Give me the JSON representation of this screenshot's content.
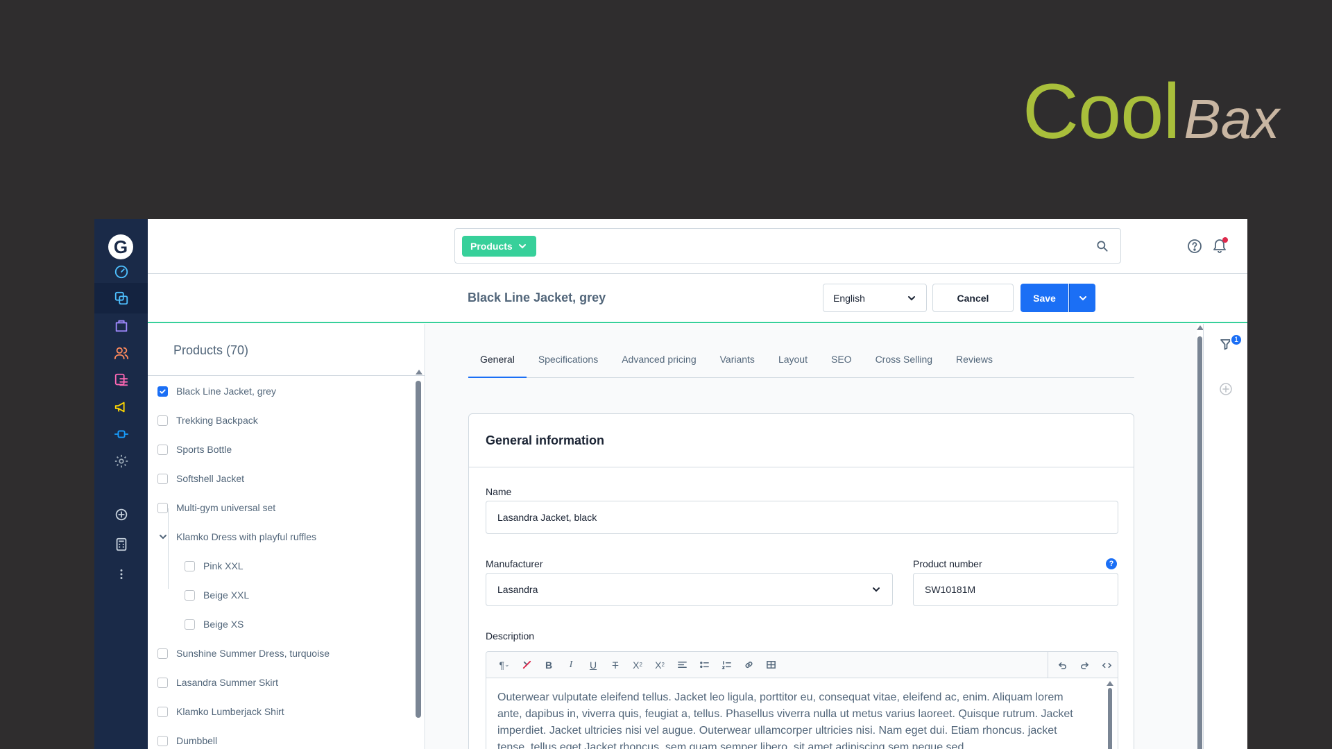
{
  "brand": {
    "cool": "Cool",
    "bax": "Bax"
  },
  "sidebar": {
    "logo": "G",
    "items": [
      {
        "icon": "dashboard-icon",
        "color": "#4ec0ff"
      },
      {
        "icon": "catalog-icon",
        "color": "#4ec0ff"
      },
      {
        "icon": "orders-icon",
        "color": "#a089ff"
      },
      {
        "icon": "customers-icon",
        "color": "#ff8a5c"
      },
      {
        "icon": "content-icon",
        "color": "#ff68b4"
      },
      {
        "icon": "marketing-icon",
        "color": "#ffd700"
      },
      {
        "icon": "extensions-icon",
        "color": "#189eff"
      },
      {
        "icon": "settings-icon",
        "color": "#9aa8b5"
      },
      {
        "icon": "add-icon",
        "color": "#c5d0db"
      },
      {
        "icon": "calculator-icon",
        "color": "#c5d0db"
      },
      {
        "icon": "more-icon",
        "color": "#c5d0db"
      }
    ]
  },
  "search": {
    "tag": "Products"
  },
  "header": {
    "title": "Black Line Jacket, grey",
    "language": "English",
    "cancel": "Cancel",
    "save": "Save"
  },
  "list": {
    "title": "Products (70)",
    "items": [
      {
        "label": "Black Line Jacket, grey",
        "checked": true,
        "level": 0
      },
      {
        "label": "Trekking Backpack",
        "checked": false,
        "level": 0
      },
      {
        "label": "Sports Bottle",
        "checked": false,
        "level": 0
      },
      {
        "label": "Softshell Jacket",
        "checked": false,
        "level": 0
      },
      {
        "label": "Multi-gym universal set",
        "checked": false,
        "level": 0
      },
      {
        "label": "Klamko Dress with playful ruffles",
        "checked": false,
        "level": 0,
        "expanded": true
      },
      {
        "label": "Pink XXL",
        "checked": false,
        "level": 1
      },
      {
        "label": "Beige XXL",
        "checked": false,
        "level": 1
      },
      {
        "label": "Beige XS",
        "checked": false,
        "level": 1
      },
      {
        "label": "Sunshine Summer Dress, turquoise",
        "checked": false,
        "level": 0
      },
      {
        "label": "Lasandra Summer Skirt",
        "checked": false,
        "level": 0
      },
      {
        "label": "Klamko Lumberjack Shirt",
        "checked": false,
        "level": 0
      },
      {
        "label": "Dumbbell",
        "checked": false,
        "level": 0
      }
    ]
  },
  "tabs": [
    "General",
    "Specifications",
    "Advanced pricing",
    "Variants",
    "Layout",
    "SEO",
    "Cross Selling",
    "Reviews"
  ],
  "general": {
    "title": "General information",
    "name_label": "Name",
    "name_value": "Lasandra Jacket, black",
    "manufacturer_label": "Manufacturer",
    "manufacturer_value": "Lasandra",
    "product_number_label": "Product number",
    "product_number_value": "SW10181M",
    "description_label": "Description",
    "description_text": "Outerwear vulputate eleifend tellus. Jacket leo ligula, porttitor eu, consequat vitae, eleifend ac, enim. Aliquam lorem ante, dapibus in, viverra quis, feugiat a, tellus. Phasellus viverra nulla ut metus varius laoreet. Quisque rutrum. Jacket imperdiet. Jacket ultricies nisi vel augue. Outerwear ullamcorper ultricies nisi. Nam eget dui. Etiam rhoncus. jacket tense. tellus eget Jacket rhoncus. sem quam semper libero. sit amet adipiscing sem neque sed"
  },
  "filter_badge": "1",
  "help_glyph": "?"
}
